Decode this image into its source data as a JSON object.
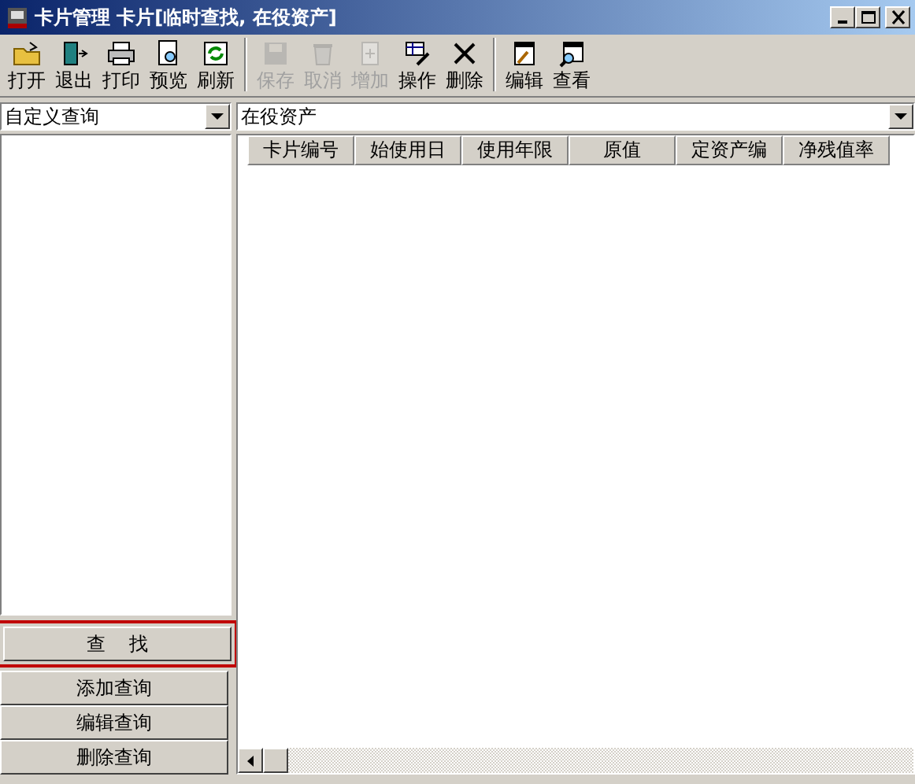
{
  "window": {
    "title": "卡片管理  卡片[临时查找, 在役资产]"
  },
  "toolbar": [
    {
      "label": "打开",
      "disabled": false,
      "separator_before": false
    },
    {
      "label": "退出",
      "disabled": false,
      "separator_before": false
    },
    {
      "label": "打印",
      "disabled": false,
      "separator_before": false
    },
    {
      "label": "预览",
      "disabled": false,
      "separator_before": false
    },
    {
      "label": "刷新",
      "disabled": false,
      "separator_before": false
    },
    {
      "label": "保存",
      "disabled": true,
      "separator_before": true
    },
    {
      "label": "取消",
      "disabled": true,
      "separator_before": false
    },
    {
      "label": "增加",
      "disabled": true,
      "separator_before": false
    },
    {
      "label": "操作",
      "disabled": false,
      "separator_before": false
    },
    {
      "label": "删除",
      "disabled": false,
      "separator_before": false
    },
    {
      "label": "编辑",
      "disabled": false,
      "separator_before": true
    },
    {
      "label": "查看",
      "disabled": false,
      "separator_before": false
    }
  ],
  "query_select": {
    "value": "自定义查询"
  },
  "query_buttons": [
    {
      "label": "查    找",
      "highlighted": true
    },
    {
      "label": "添加查询",
      "highlighted": false
    },
    {
      "label": "编辑查询",
      "highlighted": false
    },
    {
      "label": "删除查询",
      "highlighted": false
    }
  ],
  "category_select": {
    "value": "在役资产"
  },
  "table": {
    "columns": [
      "卡片编号",
      "始使用日",
      "使用年限",
      "原值",
      "定资产编",
      "净残值率"
    ]
  }
}
